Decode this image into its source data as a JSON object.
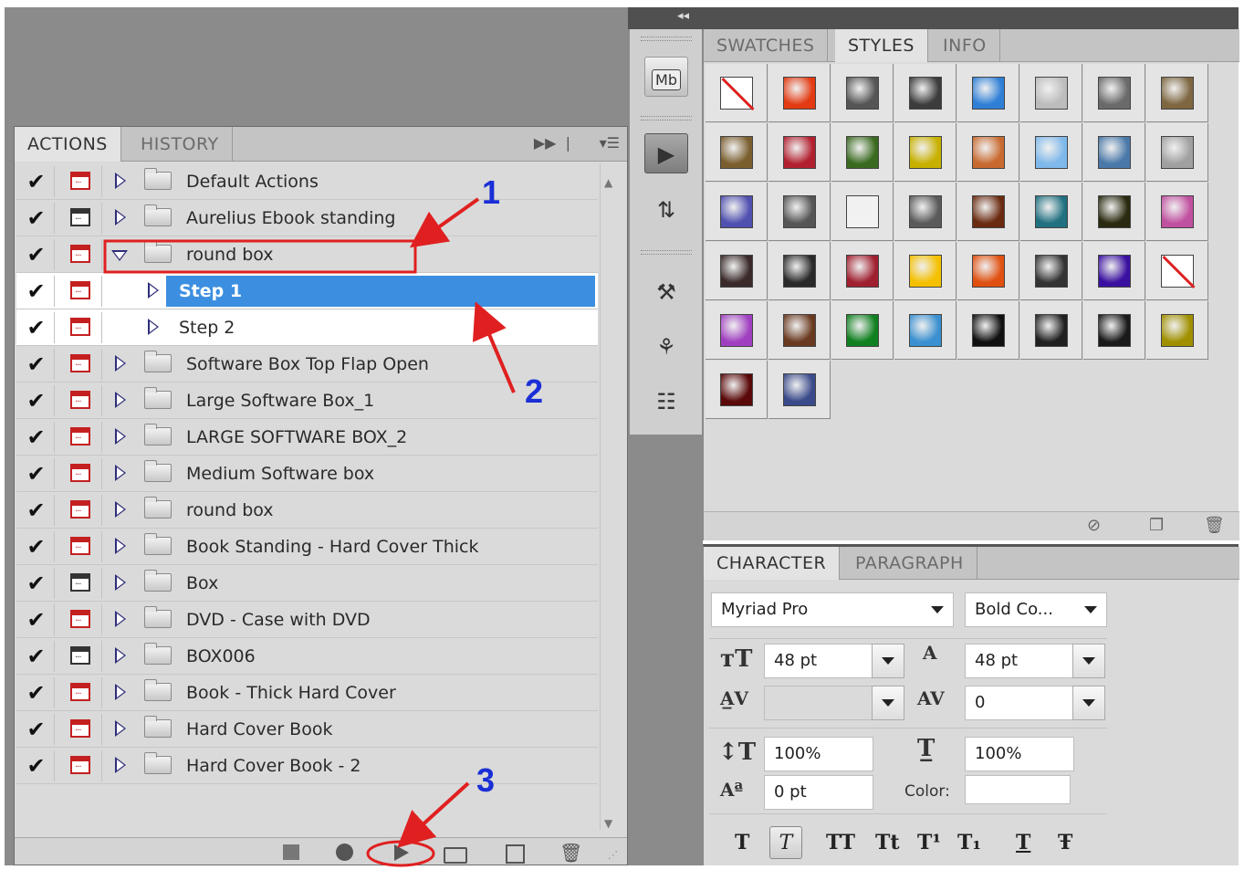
{
  "actions_panel": {
    "tabs": [
      "ACTIONS",
      "HISTORY"
    ],
    "menu_icons": [
      "fly-out-arrows-icon",
      "panel-menu-icon"
    ],
    "rows": [
      {
        "label": "Default Actions",
        "type": "set",
        "dialog": "red",
        "expanded": false
      },
      {
        "label": "Aurelius Ebook standing",
        "type": "set",
        "dialog": "black",
        "expanded": false
      },
      {
        "label": "round box",
        "type": "set",
        "dialog": "red",
        "expanded": true
      },
      {
        "label": "Step 1",
        "type": "step",
        "dialog": "red",
        "selected": true
      },
      {
        "label": "Step 2",
        "type": "step",
        "dialog": "red",
        "selected": false
      },
      {
        "label": "Software Box Top Flap Open",
        "type": "set",
        "dialog": "red",
        "expanded": false
      },
      {
        "label": "Large Software Box_1",
        "type": "set",
        "dialog": "red",
        "expanded": false
      },
      {
        "label": "LARGE SOFTWARE BOX_2",
        "type": "set",
        "dialog": "red",
        "expanded": false
      },
      {
        "label": "Medium Software box",
        "type": "set",
        "dialog": "red",
        "expanded": false
      },
      {
        "label": "round box",
        "type": "set",
        "dialog": "red",
        "expanded": false
      },
      {
        "label": "Book Standing - Hard Cover Thick",
        "type": "set",
        "dialog": "red",
        "expanded": false
      },
      {
        "label": "Box",
        "type": "set",
        "dialog": "black",
        "expanded": false
      },
      {
        "label": "DVD - Case with DVD",
        "type": "set",
        "dialog": "red",
        "expanded": false
      },
      {
        "label": "BOX006",
        "type": "set",
        "dialog": "black",
        "expanded": false
      },
      {
        "label": "Book - Thick Hard Cover",
        "type": "set",
        "dialog": "red",
        "expanded": false
      },
      {
        "label": "Hard Cover Book",
        "type": "set",
        "dialog": "red",
        "expanded": false
      },
      {
        "label": "Hard Cover Book - 2",
        "type": "set",
        "dialog": "red",
        "expanded": false
      }
    ],
    "footer_icons": [
      "stop-icon",
      "record-icon",
      "play-icon",
      "new-set-icon",
      "new-action-icon",
      "trash-icon"
    ]
  },
  "styles_panel": {
    "tabs": [
      "SWATCHES",
      "STYLES",
      "INFO"
    ],
    "active_tab": "STYLES",
    "styles": [
      "#ffffff",
      "#e33a12",
      "#555555",
      "#3c3c3c",
      "#2f7fd6",
      "#bcbcbc",
      "#6a6a6a",
      "#7d6640",
      "#7a5e2e",
      "#b22030",
      "#3a6a20",
      "#c8b000",
      "#c86a30",
      "#7fb8ea",
      "#4a78a8",
      "#a0a0a0",
      "#5050b0",
      "#555555",
      "#f2f2f2",
      "#5a5a5a",
      "#6a2a10",
      "#207080",
      "#2a2a10",
      "#c050a0",
      "#3a2a2a",
      "#2a2a2a",
      "#a02030",
      "#f4c000",
      "#e05010",
      "#333333",
      "#3a10a0",
      "#ffffff",
      "#a040c0",
      "#6a3a20",
      "#108020",
      "#3a90d0",
      "#101010",
      "#202020",
      "#1a1a1a",
      "#a09000",
      "#5a0808",
      "#3a4a8a"
    ],
    "footer_icons": [
      "clear-style-icon",
      "new-style-icon",
      "trash-icon"
    ]
  },
  "character_panel": {
    "tabs": [
      "CHARACTER",
      "PARAGRAPH"
    ],
    "font_family": "Myriad Pro",
    "font_style": "Bold Co...",
    "font_size": "48 pt",
    "leading": "48 pt",
    "kerning": "",
    "tracking": "0",
    "vertical_scale": "100%",
    "horizontal_scale": "100%",
    "baseline_shift": "0 pt",
    "color_label": "Color:",
    "format_buttons": [
      "T",
      "T",
      "TT",
      "Tt",
      "T¹",
      "T₁",
      "T",
      "Ŧ"
    ]
  },
  "annotations": {
    "markers": [
      "1",
      "2",
      "3"
    ],
    "color": "#e02020",
    "number_color": "#1a2fd6"
  }
}
